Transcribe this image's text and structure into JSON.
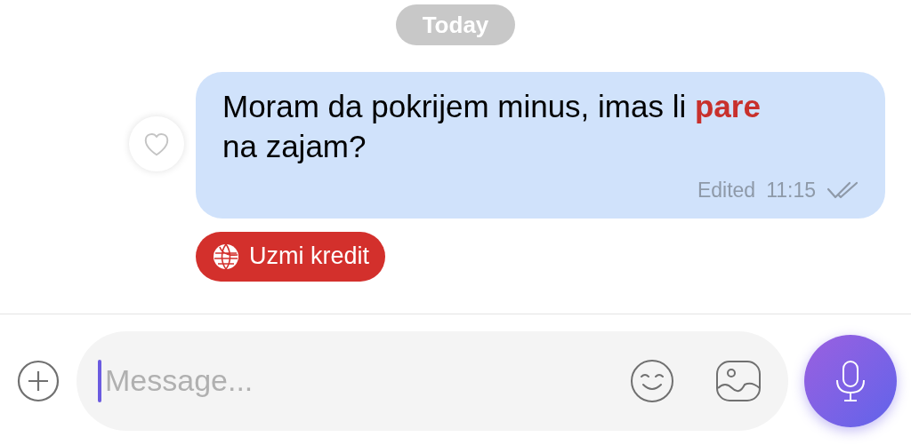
{
  "date_label": "Today",
  "message": {
    "text": "Moram da pokrijem minus, imas li **pare** na zajam?",
    "edited_label": "Edited",
    "time": "11:15",
    "liked": false
  },
  "action_button": {
    "label": "Uzmi kredit"
  },
  "composer": {
    "placeholder": "Message..."
  }
}
